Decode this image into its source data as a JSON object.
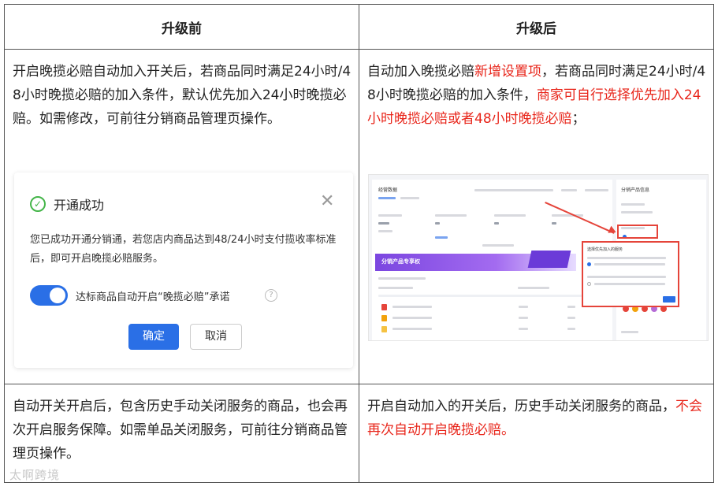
{
  "table": {
    "header_before": "升级前",
    "header_after": "升级后",
    "row1_left": "开启晚揽必赔自动加入开关后，若商品同时满足24小时/48小时晚揽必赔的加入条件，默认优先加入24小时晚揽必赔。如需修改，可前往分销商品管理页操作。",
    "row1_right_part1": "自动加入晚揽必赔",
    "row1_right_red1": "新增设置项",
    "row1_right_part2": "，若商品同时满足24小时/48小时晚揽必赔的加入条件，",
    "row1_right_red2": "商家可自行选择优先加入24小时晚揽必赔或者48小时晚揽必赔",
    "row1_right_part3": "；",
    "row2_left": "自动开关开启后，包含历史手动关闭服务的商品，也会再次开启服务保障。如需单品关闭服务，可前往分销商品管理页操作。",
    "row2_right_part1": "开启自动加入的开关后，历史手动关闭服务的商品，",
    "row2_right_red": "不会再次自动开启晚揽必赔。"
  },
  "dialog": {
    "title": "开通成功",
    "message": "您已成功开通分销通，若您店内商品达到48/24小时支付揽收率标准后，即可开启晚揽必赔服务。",
    "toggle_label": "达标商品自动开启“晚揽必赔”承诺",
    "toggle_on": true,
    "confirm_label": "确定",
    "cancel_label": "取消"
  },
  "screenshot": {
    "main_title": "经营数据",
    "banner_text": "分销产品专享权",
    "side_title": "分销产品信息",
    "popup_title": "选择优先加入的服务"
  },
  "watermark": "太啊跨境",
  "colors": {
    "accent_red": "#e8251a",
    "primary_blue": "#2a6fe6",
    "success_green": "#44b549"
  }
}
